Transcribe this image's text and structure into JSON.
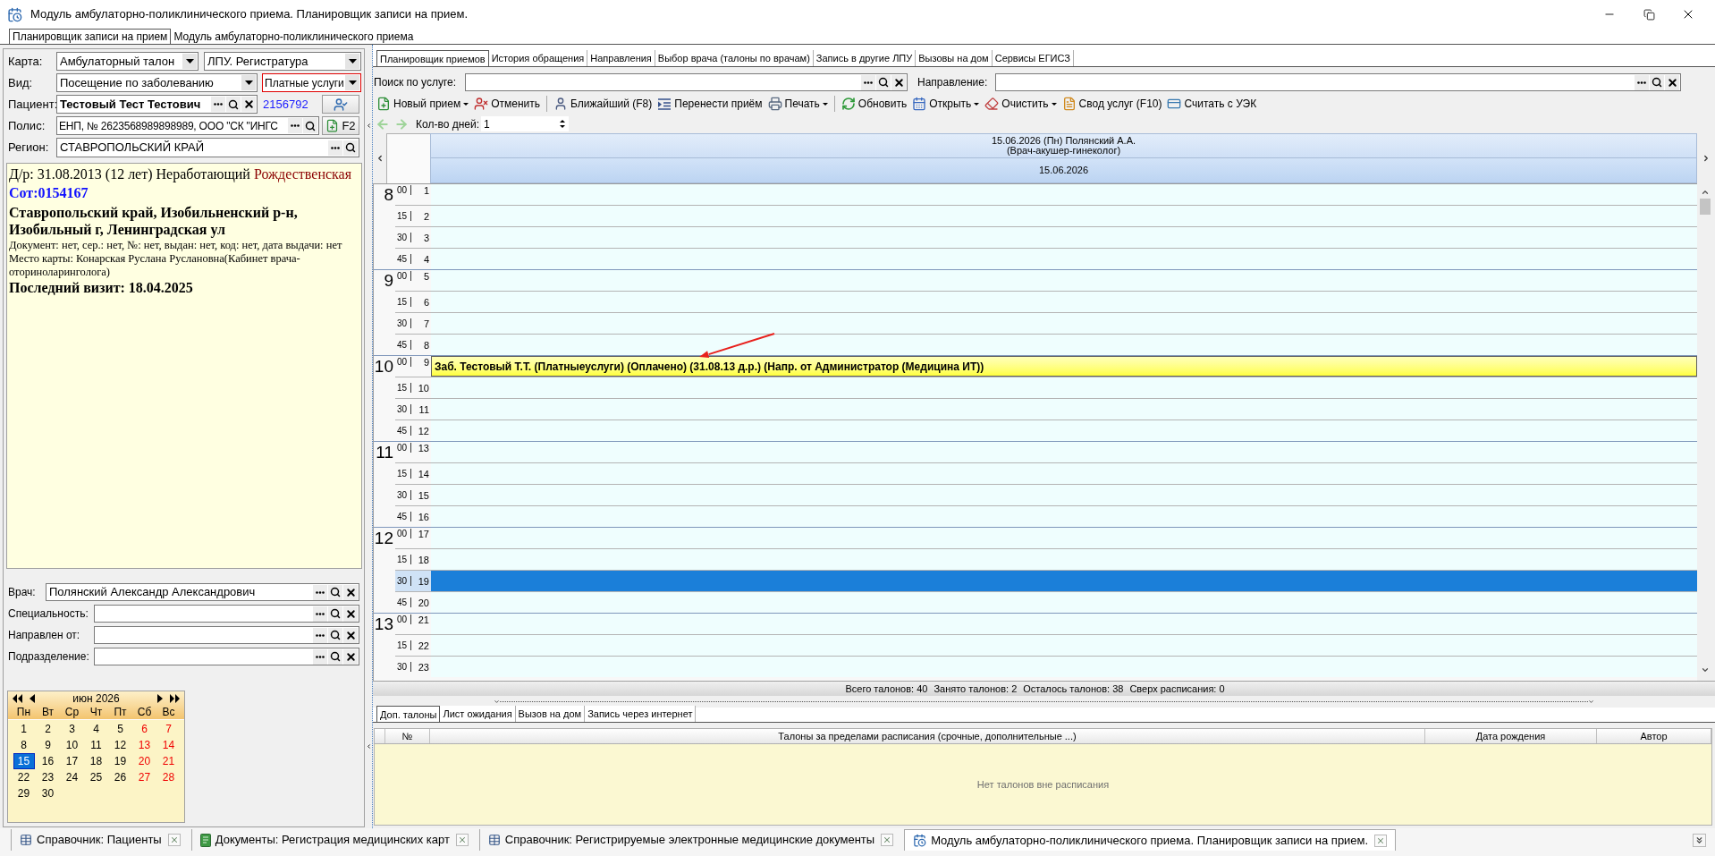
{
  "window": {
    "title": "Модуль амбулаторно-поликлинического приема. Планировщик записи на прием."
  },
  "module_tabs": [
    {
      "label": "Планировщик записи на прием",
      "selected": true
    },
    {
      "label": "Модуль амбулаторно-поликлинического приема",
      "selected": false
    }
  ],
  "left": {
    "card": {
      "label": "Карта:",
      "type": "Амбулаторный талон",
      "lpu": "ЛПУ. Регистратура"
    },
    "visit": {
      "label": "Вид:",
      "reason": "Посещение по заболеванию",
      "payment": "Платные услуги",
      "payment_highlighted": true
    },
    "patient": {
      "label": "Пациент:",
      "name": "Тестовый Тест Тестович",
      "number": "2156792"
    },
    "policy": {
      "label": "Полис:",
      "value": "ЕНП, № 2623568989898989, ООО \"СК \"ИНГС",
      "button": "F2"
    },
    "region": {
      "label": "Регион:",
      "value": "СТАВРОПОЛЬСКИЙ КРАЙ"
    },
    "info": {
      "birth": "Д/р: 31.08.2013 (12 лет) Неработающий",
      "surname": "Рождественская",
      "code": "Сот:0154167",
      "address": "Ставропольский край, Изобильненский р-н, Изобильный г, Ленинградская ул",
      "document": "Документ: нет, сер.: нет, №: нет, выдан: нет, код: нет, дата выдачи: нет",
      "card_place": "Место карты: Конарская Руслана Руслановна(Кабинет врача-оториноларинголога)",
      "last_visit": "Последний визит: 18.04.2025"
    },
    "filters": [
      {
        "label": "Врач:",
        "value": "Полянский Александр Александрович"
      },
      {
        "label": "Специальность:"
      },
      {
        "label": "Направлен от:"
      },
      {
        "label": "Подразделение:"
      }
    ],
    "calendar": {
      "month": "июн 2026",
      "weekdays": [
        "Пн",
        "Вт",
        "Ср",
        "Чт",
        "Пт",
        "Сб",
        "Вс"
      ],
      "days": [
        {
          "label": "1",
          "weekend": false,
          "selected": false
        },
        {
          "label": "2",
          "weekend": false,
          "selected": false
        },
        {
          "label": "3",
          "weekend": false,
          "selected": false
        },
        {
          "label": "4",
          "weekend": false,
          "selected": false
        },
        {
          "label": "5",
          "weekend": false,
          "selected": false
        },
        {
          "label": "6",
          "weekend": true,
          "selected": false
        },
        {
          "label": "7",
          "weekend": true,
          "selected": false
        },
        {
          "label": "8",
          "weekend": false,
          "selected": false
        },
        {
          "label": "9",
          "weekend": false,
          "selected": false
        },
        {
          "label": "10",
          "weekend": false,
          "selected": false
        },
        {
          "label": "11",
          "weekend": false,
          "selected": false
        },
        {
          "label": "12",
          "weekend": false,
          "selected": false
        },
        {
          "label": "13",
          "weekend": true,
          "selected": false
        },
        {
          "label": "14",
          "weekend": true,
          "selected": false
        },
        {
          "label": "15",
          "weekend": false,
          "selected": true
        },
        {
          "label": "16",
          "weekend": false,
          "selected": false
        },
        {
          "label": "17",
          "weekend": false,
          "selected": false
        },
        {
          "label": "18",
          "weekend": false,
          "selected": false
        },
        {
          "label": "19",
          "weekend": false,
          "selected": false
        },
        {
          "label": "20",
          "weekend": true,
          "selected": false
        },
        {
          "label": "21",
          "weekend": true,
          "selected": false
        },
        {
          "label": "22",
          "weekend": false,
          "selected": false
        },
        {
          "label": "23",
          "weekend": false,
          "selected": false
        },
        {
          "label": "24",
          "weekend": false,
          "selected": false
        },
        {
          "label": "25",
          "weekend": false,
          "selected": false
        },
        {
          "label": "26",
          "weekend": false,
          "selected": false
        },
        {
          "label": "27",
          "weekend": true,
          "selected": false
        },
        {
          "label": "28",
          "weekend": true,
          "selected": false
        },
        {
          "label": "29",
          "weekend": false,
          "selected": false
        },
        {
          "label": "30",
          "weekend": false,
          "selected": false
        }
      ]
    }
  },
  "planner": {
    "tabs": [
      {
        "label": "Планировщик приемов",
        "selected": true
      },
      {
        "label": "История обращения",
        "selected": false
      },
      {
        "label": "Направления",
        "selected": false
      },
      {
        "label": "Выбор врача (талоны по врачам)",
        "selected": false
      },
      {
        "label": "Запись в другие ЛПУ",
        "selected": false
      },
      {
        "label": "Вызовы на дом",
        "selected": false
      },
      {
        "label": "Сервисы ЕГИСЗ",
        "selected": false
      }
    ],
    "service_search": {
      "label": "Поиск по услуге:"
    },
    "referral": {
      "label": "Направление:"
    },
    "toolbar": [
      {
        "kind": "new",
        "label": "Новый прием",
        "dropdown": true,
        "separator_before": false
      },
      {
        "kind": "cancel",
        "label": "Отменить",
        "dropdown": false,
        "separator_before": false
      },
      {
        "kind": "nearest",
        "label": "Ближайший (F8)",
        "dropdown": false,
        "separator_before": true
      },
      {
        "kind": "move",
        "label": "Перенести приём",
        "dropdown": false,
        "separator_before": false
      },
      {
        "kind": "print",
        "label": "Печать",
        "dropdown": true,
        "separator_before": false
      },
      {
        "kind": "refresh",
        "label": "Обновить",
        "dropdown": false,
        "separator_before": true
      },
      {
        "kind": "open",
        "label": "Открыть",
        "dropdown": true,
        "separator_before": false
      },
      {
        "kind": "clear",
        "label": "Очистить",
        "dropdown": true,
        "separator_before": false
      },
      {
        "kind": "summary",
        "label": "Свод услуг (F10)",
        "dropdown": false,
        "separator_before": false
      },
      {
        "kind": "card",
        "label": "Считать с УЭК",
        "dropdown": false,
        "separator_before": false
      }
    ],
    "days_count": {
      "label": "Кол-во дней:",
      "value": "1"
    },
    "schedule": {
      "title": "15.06.2026 (Пн) Полянский А.А.",
      "subtitle": "(Врач-акушер-гинеколог)",
      "date": "15.06.2026",
      "annotation": {
        "kind": "arrow"
      },
      "hours": [
        {
          "hour": "8",
          "slots": [
            {
              "minute": "00",
              "number": "1",
              "selected": false
            },
            {
              "minute": "15",
              "number": "2",
              "selected": false
            },
            {
              "minute": "30",
              "number": "3",
              "selected": false
            },
            {
              "minute": "45",
              "number": "4",
              "selected": false
            }
          ]
        },
        {
          "hour": "9",
          "slots": [
            {
              "minute": "00",
              "number": "5",
              "selected": false
            },
            {
              "minute": "15",
              "number": "6",
              "selected": false
            },
            {
              "minute": "30",
              "number": "7",
              "selected": false
            },
            {
              "minute": "45",
              "number": "8",
              "selected": false
            }
          ]
        },
        {
          "hour": "10",
          "slots": [
            {
              "minute": "00",
              "number": "9",
              "selected": false,
              "appointment": "Заб. Тестовый Т.Т. (Платныеуслуги) (Оплачено) (31.08.13 д.р.) (Напр. от Администратор (Медицина ИТ))"
            },
            {
              "minute": "15",
              "number": "10",
              "selected": false
            },
            {
              "minute": "30",
              "number": "11",
              "selected": false
            },
            {
              "minute": "45",
              "number": "12",
              "selected": false
            }
          ]
        },
        {
          "hour": "11",
          "slots": [
            {
              "minute": "00",
              "number": "13",
              "selected": false
            },
            {
              "minute": "15",
              "number": "14",
              "selected": false
            },
            {
              "minute": "30",
              "number": "15",
              "selected": false
            },
            {
              "minute": "45",
              "number": "16",
              "selected": false
            }
          ]
        },
        {
          "hour": "12",
          "slots": [
            {
              "minute": "00",
              "number": "17",
              "selected": false
            },
            {
              "minute": "15",
              "number": "18",
              "selected": false
            },
            {
              "minute": "30",
              "number": "19",
              "selected": true
            },
            {
              "minute": "45",
              "number": "20",
              "selected": false
            }
          ]
        },
        {
          "hour": "13",
          "slots": [
            {
              "minute": "00",
              "number": "21",
              "selected": false
            },
            {
              "minute": "15",
              "number": "22",
              "selected": false
            },
            {
              "minute": "30",
              "number": "23",
              "selected": false
            }
          ]
        }
      ]
    },
    "summary": [
      "Всего талонов: 40",
      "Занято талонов: 2",
      "Осталось талонов: 38",
      "Сверх расписания: 0"
    ],
    "bottom_tabs": [
      {
        "label": "Доп. талоны",
        "selected": true
      },
      {
        "label": "Лист ожидания",
        "selected": false
      },
      {
        "label": "Вызов на дом",
        "selected": false
      },
      {
        "label": "Запись через интернет",
        "selected": false
      }
    ],
    "extra_table": {
      "columns": [
        "№",
        "Талоны за пределами расписания (срочные, дополнительные ...)",
        "Дата рождения",
        "Автор"
      ],
      "empty_text": "Нет талонов вне расписания"
    }
  },
  "taskbar": [
    {
      "kind": "table",
      "label": "Справочник: Пациенты",
      "selected": false
    },
    {
      "kind": "document",
      "label": "Документы: Регистрация медицинских карт",
      "selected": false
    },
    {
      "kind": "table",
      "label": "Справочник: Регистрируемые электронные медицинские документы",
      "selected": false
    },
    {
      "kind": "scheduler",
      "label": "Модуль амбулаторно-поликлинического приема. Планировщик записи на прием.",
      "selected": true
    }
  ]
}
